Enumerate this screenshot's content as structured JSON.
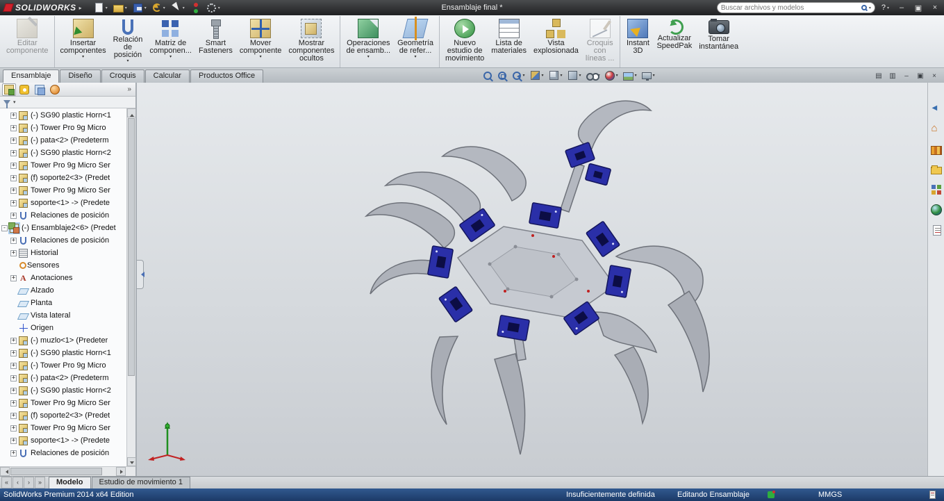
{
  "colors": {
    "brand_red": "#d1202a",
    "servo_blue": "#2a2fa8",
    "plate_gray": "#c6cad1",
    "statusbar_blue": "#1d3f72",
    "viewport_gradient_top": "#e6e9ec",
    "viewport_gradient_bottom": "#c8ccd1"
  },
  "titlebar": {
    "logo": "SOLIDWORKS",
    "logo_arrow": "▸",
    "title": "Ensamblaje final *",
    "search": {
      "placeholder": "Buscar archivos y modelos",
      "caret": "▾"
    },
    "help_label": "?",
    "help_caret": "▾",
    "window_buttons": {
      "minimize": "–",
      "restore": "▣",
      "close": "×"
    },
    "quick_access": [
      {
        "name": "new-document-button",
        "icon": "qa-new",
        "caret": "▾"
      },
      {
        "name": "open-document-button",
        "icon": "qa-open",
        "caret": "▾"
      },
      {
        "name": "save-button",
        "icon": "qa-save",
        "caret": "▾"
      },
      {
        "name": "undo-button",
        "icon": "qa-undo",
        "caret": "▾"
      },
      {
        "name": "select-button",
        "icon": "qa-select",
        "caret": "▾"
      },
      {
        "name": "rebuild-button",
        "icon": "qa-rebuild",
        "caret": ""
      },
      {
        "name": "options-button",
        "icon": "qa-options",
        "caret": "▾"
      }
    ]
  },
  "ribbon": {
    "buttons": [
      {
        "name": "editar-componente-button",
        "icon_name": "edit-component-icon",
        "icon": "i-edit",
        "l1": "Editar",
        "l2": "componente",
        "l3": "",
        "caret": "",
        "cls": "dis"
      },
      {
        "name": "insertar-componentes-button",
        "icon_name": "insert-components-icon",
        "icon": "i-insert",
        "l1": "Insertar",
        "l2": "componentes",
        "l3": "",
        "caret": "▾",
        "cls": "grp"
      },
      {
        "name": "relacion-de-posicion-button",
        "icon_name": "mate-paperclip-icon",
        "icon": "i-mate",
        "l1": "Relación",
        "l2": "de",
        "l3": "posición",
        "caret": "▾",
        "cls": ""
      },
      {
        "name": "matriz-de-componentes-button",
        "icon_name": "component-pattern-icon",
        "icon": "i-pattern",
        "l1": "Matriz de",
        "l2": "componen...",
        "l3": "",
        "caret": "▾",
        "cls": ""
      },
      {
        "name": "smart-fasteners-button",
        "icon_name": "smart-fasteners-bolt-icon",
        "icon": "i-fastener",
        "l1": "Smart",
        "l2": "Fasteners",
        "l3": "",
        "caret": "",
        "cls": ""
      },
      {
        "name": "mover-componente-button",
        "icon_name": "move-component-icon",
        "icon": "i-move",
        "l1": "Mover",
        "l2": "componente",
        "l3": "",
        "caret": "▾",
        "cls": ""
      },
      {
        "name": "mostrar-componentes-ocultos-button",
        "icon_name": "show-hidden-components-icon",
        "icon": "i-hidden",
        "l1": "Mostrar",
        "l2": "componentes",
        "l3": "ocultos",
        "caret": "",
        "cls": ""
      },
      {
        "name": "operaciones-de-ensamblaje-button",
        "icon_name": "assembly-features-icon",
        "icon": "i-features",
        "l1": "Operaciones",
        "l2": "de ensamb...",
        "l3": "",
        "caret": "▾",
        "cls": "grp"
      },
      {
        "name": "geometria-de-referencia-button",
        "icon_name": "reference-geometry-icon",
        "icon": "i-refgeom",
        "l1": "Geometría",
        "l2": "de refer...",
        "l3": "",
        "caret": "▾",
        "cls": ""
      },
      {
        "name": "nuevo-estudio-de-movimiento-button",
        "icon_name": "motion-study-icon",
        "icon": "i-motion",
        "l1": "Nuevo",
        "l2": "estudio de",
        "l3": "movimiento",
        "caret": "",
        "cls": "grp"
      },
      {
        "name": "lista-de-materiales-button",
        "icon_name": "bill-of-materials-icon",
        "icon": "i-bom",
        "l1": "Lista de",
        "l2": "materiales",
        "l3": "",
        "caret": "",
        "cls": ""
      },
      {
        "name": "vista-explosionada-button",
        "icon_name": "exploded-view-icon",
        "icon": "i-explode",
        "l1": "Vista",
        "l2": "explosionada",
        "l3": "",
        "caret": "",
        "cls": ""
      },
      {
        "name": "croquis-con-lineas-button",
        "icon_name": "sketch-lines-icon",
        "icon": "i-sketch",
        "l1": "Croquis",
        "l2": "con",
        "l3": "líneas ...",
        "caret": "",
        "cls": "dis"
      },
      {
        "name": "instant-3d-button",
        "icon_name": "instant-3d-icon",
        "icon": "i-instant3d",
        "l1": "Instant",
        "l2": "3D",
        "l3": "",
        "caret": "",
        "cls": "grp"
      },
      {
        "name": "actualizar-speedpak-button",
        "icon_name": "update-speedpak-icon",
        "icon": "i-speedpak",
        "l1": "Actualizar",
        "l2": "SpeedPak",
        "l3": "",
        "caret": "",
        "cls": ""
      },
      {
        "name": "tomar-instantanea-button",
        "icon_name": "take-snapshot-camera-icon",
        "icon": "i-snapshot",
        "l1": "Tomar",
        "l2": "instantánea",
        "l3": "",
        "caret": "",
        "cls": ""
      }
    ]
  },
  "command_tabs": [
    {
      "name": "tab-ensamblaje",
      "label": "Ensamblaje",
      "cls": "active"
    },
    {
      "name": "tab-diseno",
      "label": "Diseño",
      "cls": ""
    },
    {
      "name": "tab-croquis",
      "label": "Croquis",
      "cls": ""
    },
    {
      "name": "tab-calcular",
      "label": "Calcular",
      "cls": ""
    },
    {
      "name": "tab-productos-office",
      "label": "Productos Office",
      "cls": ""
    }
  ],
  "headsup": [
    {
      "name": "zoom-to-fit-button",
      "icon": "h-zoomfit",
      "caret": ""
    },
    {
      "name": "zoom-to-area-button",
      "icon": "h-zoomarea",
      "caret": ""
    },
    {
      "name": "previous-view-button",
      "icon": "h-prevview",
      "caret": "▾"
    },
    {
      "name": "section-view-button",
      "icon": "h-section",
      "caret": "▾"
    },
    {
      "name": "view-orientation-button",
      "icon": "h-orient",
      "caret": "▾"
    },
    {
      "name": "display-style-button",
      "icon": "h-display",
      "caret": "▾"
    },
    {
      "name": "hide-show-items-button",
      "icon": "h-hideshow",
      "caret": "▾"
    },
    {
      "name": "edit-appearance-button",
      "icon": "h-appearance",
      "caret": "▾"
    },
    {
      "name": "apply-scene-button",
      "icon": "h-scene",
      "caret": "▾"
    },
    {
      "name": "view-settings-button",
      "icon": "h-settings",
      "caret": "▾"
    }
  ],
  "doc_window_buttons": [
    {
      "name": "viewport-layout-button",
      "glyph": "▤"
    },
    {
      "name": "viewport-split-button",
      "glyph": "▥"
    },
    {
      "name": "document-minimize-button",
      "glyph": "–"
    },
    {
      "name": "document-restore-button",
      "glyph": "▣"
    },
    {
      "name": "document-close-button",
      "glyph": "×"
    }
  ],
  "panel": {
    "more_label": "»",
    "filter_caret": "▾",
    "tabs": [
      {
        "name": "featuremanager-tab",
        "icon": "pt-feature",
        "cls": "active"
      },
      {
        "name": "propertymanager-tab",
        "icon": "pt-property",
        "cls": ""
      },
      {
        "name": "configurationmanager-tab",
        "icon": "pt-config",
        "cls": ""
      },
      {
        "name": "displaymanager-tab",
        "icon": "pt-display",
        "cls": ""
      }
    ]
  },
  "tree": {
    "items": [
      {
        "icon": "i-part",
        "expand": "+",
        "label": "(-) SG90 plastic Horn<1",
        "cls": "ind1"
      },
      {
        "icon": "i-part",
        "expand": "+",
        "label": "(-) Tower Pro 9g Micro",
        "cls": "ind1"
      },
      {
        "icon": "i-part",
        "expand": "+",
        "label": "(-) pata<2> (Predeterm",
        "cls": "ind1"
      },
      {
        "icon": "i-part",
        "expand": "+",
        "label": "(-) SG90 plastic Horn<2",
        "cls": "ind1"
      },
      {
        "icon": "i-part",
        "expand": "+",
        "label": "Tower Pro 9g Micro Ser",
        "cls": "ind1"
      },
      {
        "icon": "i-part",
        "expand": "+",
        "label": "(f) soporte2<3> (Predet",
        "cls": "ind1"
      },
      {
        "icon": "i-part",
        "expand": "+",
        "label": "Tower Pro 9g Micro Ser",
        "cls": "ind1"
      },
      {
        "icon": "i-part",
        "expand": "+",
        "label": "soporte<1> -> (Predete",
        "cls": "ind1"
      },
      {
        "icon": "i-mates",
        "expand": "+",
        "label": "Relaciones de posición",
        "cls": "ind1"
      },
      {
        "icon": "i-asm",
        "expand": "-",
        "label": "(-) Ensamblaje2<6> (Predet",
        "cls": "hilite"
      },
      {
        "icon": "i-mates",
        "expand": "+",
        "label": "Relaciones de posición",
        "cls": "ind1"
      },
      {
        "icon": "i-hist",
        "expand": "+",
        "label": "Historial",
        "cls": "ind1"
      },
      {
        "icon": "i-sens",
        "expand": "",
        "label": "Sensores",
        "cls": "ind1"
      },
      {
        "icon": "i-ann",
        "expand": "+",
        "label": "Anotaciones",
        "cls": "ind1"
      },
      {
        "icon": "i-plane",
        "expand": "",
        "label": "Alzado",
        "cls": "ind1"
      },
      {
        "icon": "i-plane",
        "expand": "",
        "label": "Planta",
        "cls": "ind1"
      },
      {
        "icon": "i-plane",
        "expand": "",
        "label": "Vista lateral",
        "cls": "ind1"
      },
      {
        "icon": "i-origin",
        "expand": "",
        "label": "Origen",
        "cls": "ind1"
      },
      {
        "icon": "i-part",
        "expand": "+",
        "label": "(-) muzlo<1> (Predeter",
        "cls": "ind1"
      },
      {
        "icon": "i-part",
        "expand": "+",
        "label": "(-) SG90 plastic Horn<1",
        "cls": "ind1"
      },
      {
        "icon": "i-part",
        "expand": "+",
        "label": "(-) Tower Pro 9g Micro",
        "cls": "ind1"
      },
      {
        "icon": "i-part",
        "expand": "+",
        "label": "(-) pata<2> (Predeterm",
        "cls": "ind1"
      },
      {
        "icon": "i-part",
        "expand": "+",
        "label": "(-) SG90 plastic Horn<2",
        "cls": "ind1"
      },
      {
        "icon": "i-part",
        "expand": "+",
        "label": "Tower Pro 9g Micro Ser",
        "cls": "ind1"
      },
      {
        "icon": "i-part",
        "expand": "+",
        "label": "(f) soporte2<3> (Predet",
        "cls": "ind1"
      },
      {
        "icon": "i-part",
        "expand": "+",
        "label": "Tower Pro 9g Micro Ser",
        "cls": "ind1"
      },
      {
        "icon": "i-part",
        "expand": "+",
        "label": "soporte<1> -> (Predete",
        "cls": "ind1"
      },
      {
        "icon": "i-mates",
        "expand": "+",
        "label": "Relaciones de posición",
        "cls": "ind1"
      }
    ]
  },
  "taskpane": {
    "icons": [
      {
        "name": "task-pane-collapse-button",
        "icon": "tp-collapse"
      },
      {
        "name": "solidworks-resources-button",
        "icon": "tp-home"
      },
      {
        "name": "design-library-button",
        "icon": "tp-library"
      },
      {
        "name": "file-explorer-button",
        "icon": "tp-explorer"
      },
      {
        "name": "view-palette-button",
        "icon": "tp-palette"
      },
      {
        "name": "appearances-scenes-button",
        "icon": "tp-globe"
      },
      {
        "name": "custom-properties-button",
        "icon": "tp-props"
      }
    ]
  },
  "bottom": {
    "nav": [
      {
        "name": "first-tab-button",
        "glyph": "«"
      },
      {
        "name": "prev-tab-button",
        "glyph": "‹"
      },
      {
        "name": "next-tab-button",
        "glyph": "›"
      },
      {
        "name": "last-tab-button",
        "glyph": "»"
      }
    ],
    "tabs": [
      {
        "name": "tab-modelo",
        "label": "Modelo",
        "cls": "active"
      },
      {
        "name": "tab-estudio-de-movimiento-1",
        "label": "Estudio de movimiento 1",
        "cls": ""
      }
    ]
  },
  "statusbar": {
    "edition": "SolidWorks Premium 2014 x64 Edition",
    "definition": "Insuficientemente definida",
    "editing": "Editando Ensamblaje",
    "units": "MMGS"
  }
}
